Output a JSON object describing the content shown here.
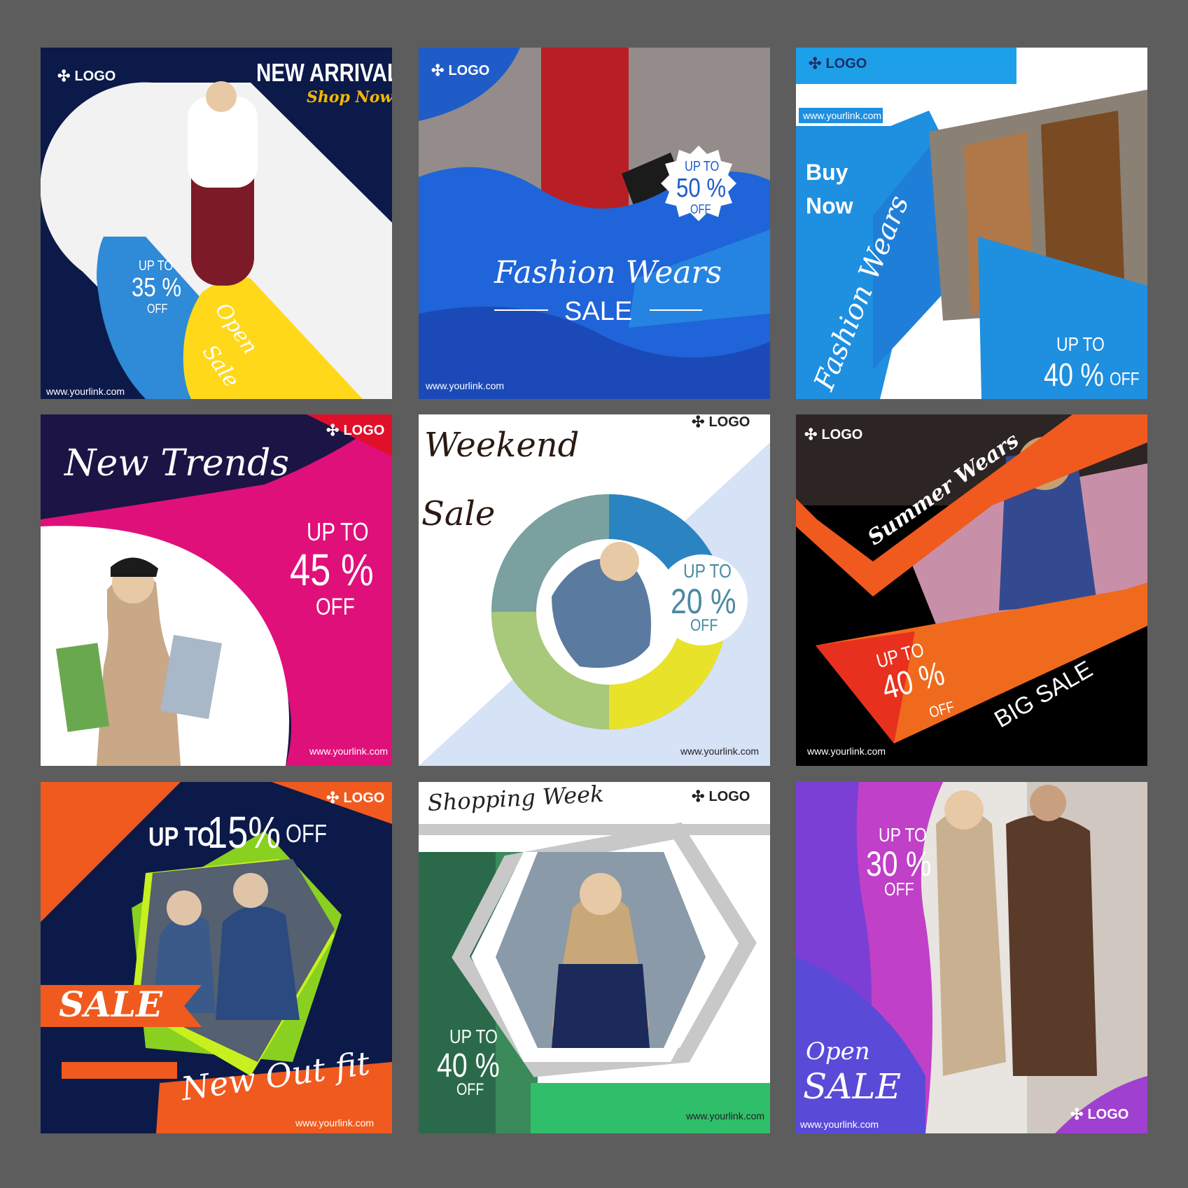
{
  "banners": [
    {
      "logo": "LOGO",
      "headline": "NEW ARRIVALS",
      "tagline": "Shop Now",
      "discount": {
        "pre": "UP TO",
        "value": "35 %",
        "post": "OFF"
      },
      "ribbon": [
        "Open",
        "Sale"
      ],
      "url": "www.yourlink.com"
    },
    {
      "logo": "LOGO",
      "badge": {
        "pre": "UP TO",
        "value": "50 %",
        "post": "OFF"
      },
      "headline": "Fashion Wears",
      "subline": "SALE",
      "url": "www.yourlink.com"
    },
    {
      "logo": "LOGO",
      "url_top": "www.yourlink.com",
      "cta": [
        "Buy",
        "Now"
      ],
      "headline": "Fashion Wears",
      "discount": {
        "pre": "UP TO",
        "value": "40 %",
        "post": "OFF"
      }
    },
    {
      "logo": "LOGO",
      "headline": "New Trends",
      "discount": {
        "pre": "UP TO",
        "value": "45 %",
        "post": "OFF"
      },
      "url": "www.yourlink.com"
    },
    {
      "logo": "LOGO",
      "headline": [
        "Weekend",
        "Sale"
      ],
      "discount": {
        "pre": "UP TO",
        "value": "20 %",
        "post": "OFF"
      },
      "url": "www.yourlink.com"
    },
    {
      "logo": "LOGO",
      "headline": "Summer Wears",
      "discount": {
        "pre": "UP TO",
        "value": "40 %",
        "post": "OFF"
      },
      "subline": "BIG SALE",
      "url": "www.yourlink.com"
    },
    {
      "logo": "LOGO",
      "headline": {
        "pre": "UP TO",
        "value": "15%",
        "post": "OFF"
      },
      "ribbon": "SALE",
      "subline": "New Out fit",
      "url": "www.yourlink.com"
    },
    {
      "logo": "LOGO",
      "headline": "Shopping Week",
      "discount": {
        "pre": "UP TO",
        "value": "40 %",
        "post": "OFF"
      },
      "url": "www.yourlink.com"
    },
    {
      "logo": "LOGO",
      "discount": {
        "pre": "UP TO",
        "value": "30 %",
        "post": "OFF"
      },
      "headline": [
        "Open",
        "SALE"
      ],
      "url": "www.yourlink.com"
    }
  ],
  "colors": {
    "navy": "#0c1a4a",
    "blue": "#1f8fe0",
    "yellow": "#ffd81a",
    "magenta": "#e0107a",
    "orange": "#f05a1e",
    "green": "#2fbf6a",
    "purple": "#7b3fd6"
  },
  "icons": {
    "logo_mark": "pinwheel-icon"
  }
}
